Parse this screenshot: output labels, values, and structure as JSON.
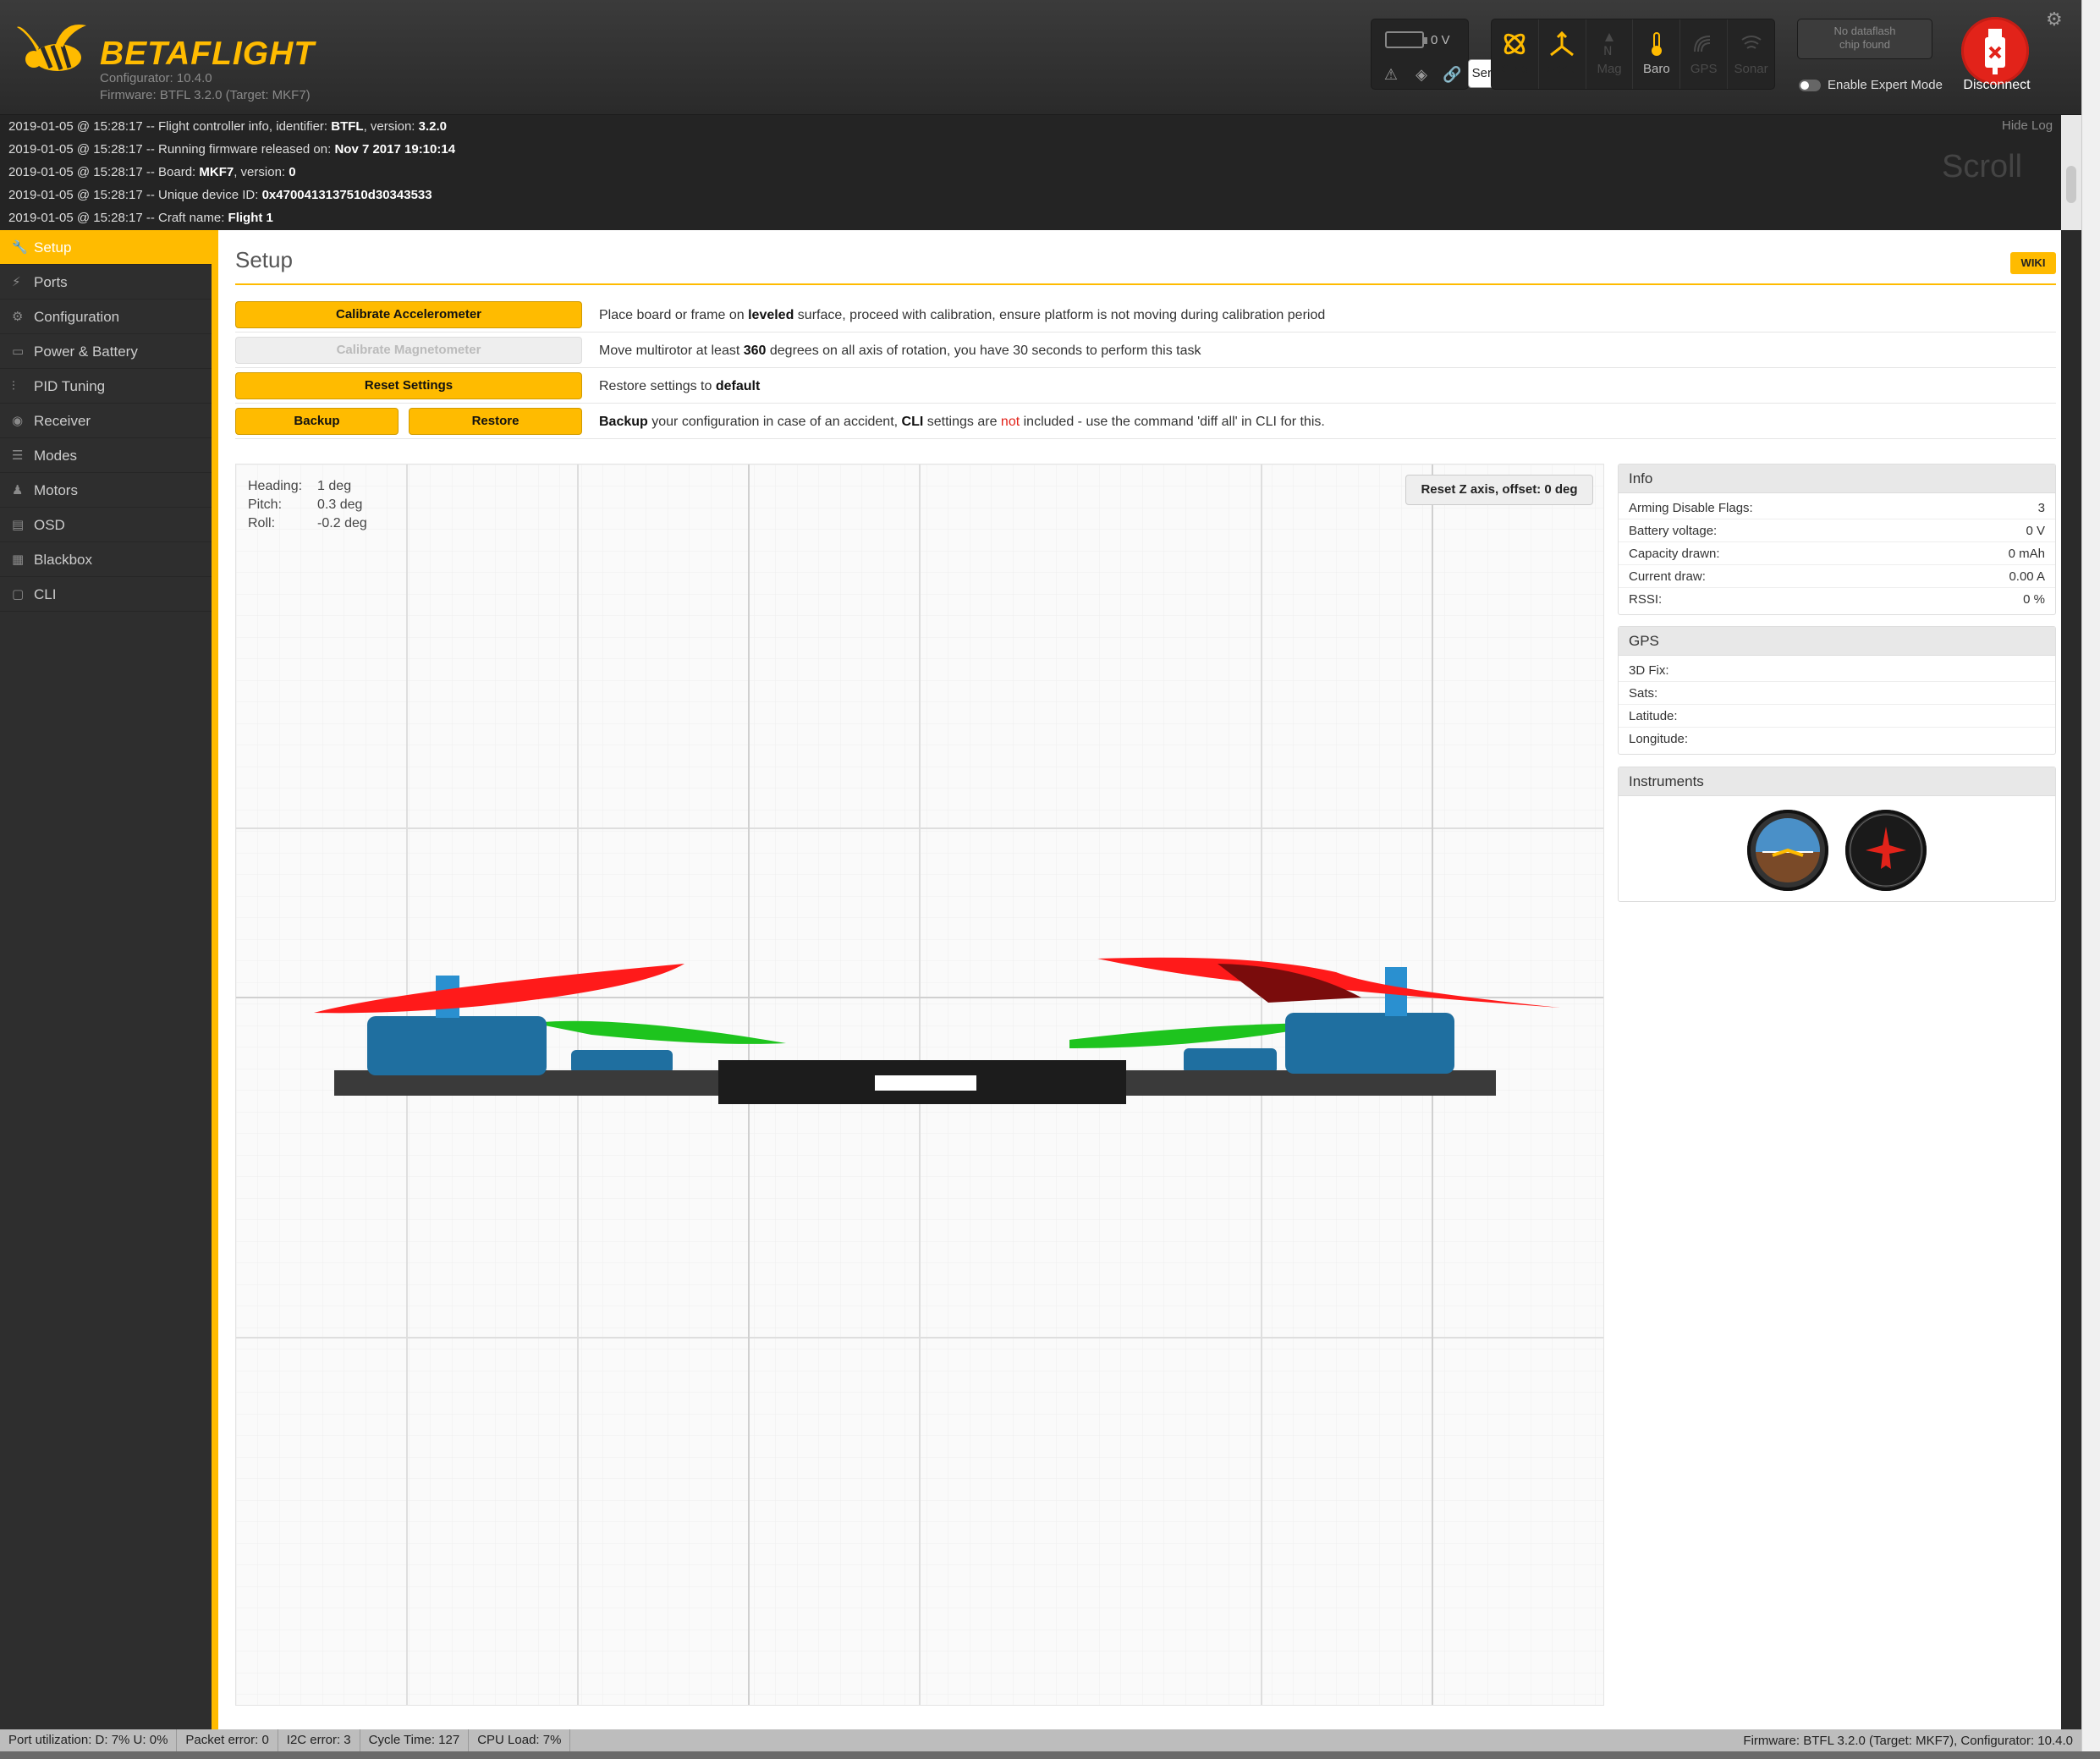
{
  "header": {
    "brand": "BETAFLIGHT",
    "configurator": "Configurator: 10.4.0",
    "firmware": "Firmware: BTFL 3.2.0 (Target: MKF7)",
    "battery": "0 V",
    "tooltip": "Serial Link Status",
    "sensors": [
      {
        "name": "Gyro",
        "icon": "gyro-icon",
        "active": true
      },
      {
        "name": "Accel",
        "icon": "accel-icon",
        "active": true
      },
      {
        "name": "Mag",
        "icon": "mag-icon",
        "active": false
      },
      {
        "name": "Baro",
        "icon": "baro-icon",
        "active": true
      },
      {
        "name": "GPS",
        "icon": "gps-icon",
        "active": false
      },
      {
        "name": "Sonar",
        "icon": "sonar-icon",
        "active": false
      }
    ],
    "dataflash_line1": "No dataflash",
    "dataflash_line2": "chip found",
    "expert_mode": "Enable Expert Mode",
    "disconnect": "Disconnect",
    "accent": "#ffbb00",
    "disconnect_color": "#e2231a"
  },
  "log": {
    "hide": "Hide Log",
    "scroll": "Scroll",
    "lines": [
      {
        "pre": "2019-01-05 @ 15:28:17 -- Flight controller info, identifier: ",
        "b1": "BTFL",
        "mid": ", version: ",
        "b2": "3.2.0"
      },
      {
        "pre": "2019-01-05 @ 15:28:17 -- Running firmware released on: ",
        "b1": "Nov 7 2017 19:10:14",
        "mid": "",
        "b2": ""
      },
      {
        "pre": "2019-01-05 @ 15:28:17 -- Board: ",
        "b1": "MKF7",
        "mid": ", version: ",
        "b2": "0"
      },
      {
        "pre": "2019-01-05 @ 15:28:17 -- Unique device ID: ",
        "b1": "0x4700413137510d30343533",
        "mid": "",
        "b2": ""
      },
      {
        "pre": "2019-01-05 @ 15:28:17 -- Craft name: ",
        "b1": "Flight 1",
        "mid": "",
        "b2": ""
      }
    ]
  },
  "nav": [
    {
      "label": "Setup",
      "icon": "wrench-icon",
      "active": true
    },
    {
      "label": "Ports",
      "icon": "plug-icon"
    },
    {
      "label": "Configuration",
      "icon": "gear-icon"
    },
    {
      "label": "Power & Battery",
      "icon": "battery-icon"
    },
    {
      "label": "PID Tuning",
      "icon": "pid-icon"
    },
    {
      "label": "Receiver",
      "icon": "receiver-icon"
    },
    {
      "label": "Modes",
      "icon": "modes-icon"
    },
    {
      "label": "Motors",
      "icon": "motor-icon"
    },
    {
      "label": "OSD",
      "icon": "osd-icon"
    },
    {
      "label": "Blackbox",
      "icon": "blackbox-icon"
    },
    {
      "label": "CLI",
      "icon": "cli-icon"
    }
  ],
  "setup": {
    "title": "Setup",
    "wiki": "WIKI",
    "calibrate_acc": "Calibrate Accelerometer",
    "calibrate_acc_text": {
      "a": "Place board or frame on ",
      "b": "leveled",
      "c": " surface, proceed with calibration, ensure platform is not moving during calibration period"
    },
    "calibrate_mag": "Calibrate Magnetometer",
    "calibrate_mag_text": {
      "a": "Move multirotor at least ",
      "b": "360",
      "c": " degrees on all axis of rotation, you have 30 seconds to perform this task"
    },
    "reset": "Reset Settings",
    "reset_text": {
      "a": "Restore settings to ",
      "b": "default"
    },
    "backup": "Backup",
    "restore": "Restore",
    "backup_text": {
      "a": "Backup",
      "b": " your configuration in case of an accident, ",
      "c": "CLI",
      "d": " settings are ",
      "e": "not",
      "f": " included - use the command 'diff all' in CLI for this."
    },
    "heading_label": "Heading:",
    "heading": "1 deg",
    "pitch_label": "Pitch:",
    "pitch": "0.3 deg",
    "roll_label": "Roll:",
    "roll": "-0.2 deg",
    "reset_z": "Reset Z axis, offset: 0 deg"
  },
  "info": {
    "title": "Info",
    "rows": [
      {
        "label": "Arming Disable Flags:",
        "value": "3"
      },
      {
        "label": "Battery voltage:",
        "value": "0 V"
      },
      {
        "label": "Capacity drawn:",
        "value": "0 mAh"
      },
      {
        "label": "Current draw:",
        "value": "0.00 A"
      },
      {
        "label": "RSSI:",
        "value": "0 %"
      }
    ]
  },
  "gps": {
    "title": "GPS",
    "rows": [
      {
        "label": "3D Fix:",
        "value": ""
      },
      {
        "label": "Sats:",
        "value": ""
      },
      {
        "label": "Latitude:",
        "value": ""
      },
      {
        "label": "Longitude:",
        "value": ""
      }
    ]
  },
  "instruments": {
    "title": "Instruments"
  },
  "status": {
    "port": "Port utilization: D: 7% U: 0%",
    "packet": "Packet error: 0",
    "i2c": "I2C error: 3",
    "cycle": "Cycle Time: 127",
    "cpu": "CPU Load: 7%",
    "firmware": "Firmware: BTFL 3.2.0 (Target: MKF7), Configurator: 10.4.0"
  }
}
